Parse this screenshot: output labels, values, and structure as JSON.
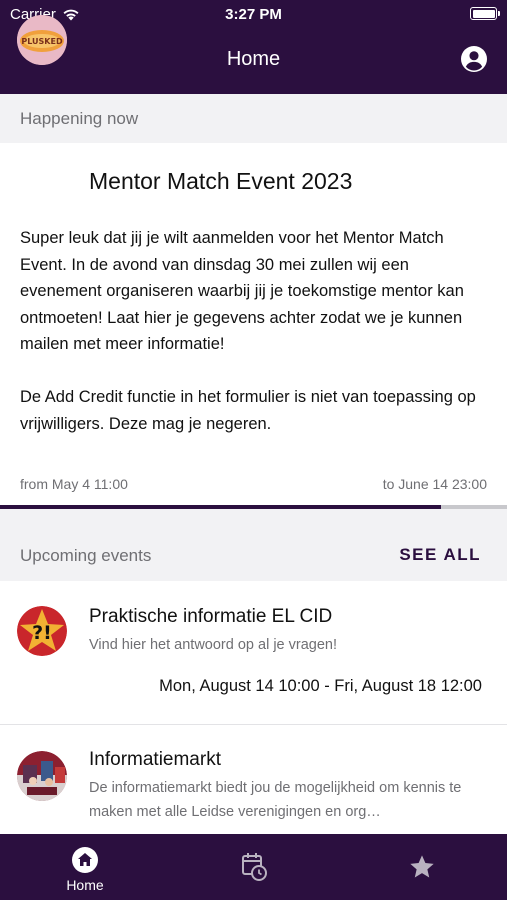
{
  "status_bar": {
    "carrier": "Carrier",
    "time": "3:27 PM"
  },
  "nav": {
    "title": "Home",
    "account_icon": "account-circle-icon"
  },
  "happening_now": {
    "header": "Happening now",
    "event": {
      "title": "Mentor Match Event 2023",
      "logo_text": "PLUSKED",
      "paragraphs": [
        "Super leuk dat jij je wilt aanmelden voor het Mentor Match Event. In de avond van dinsdag 30 mei zullen wij een evenement organiseren waarbij jij je toekomstige mentor kan ontmoeten! Laat hier je gegevens achter zodat we je kunnen mailen met meer informatie!",
        "De Add Credit functie in het formulier is niet van toepassing op vrijwilligers. Deze mag je negeren."
      ],
      "from": "from May 4 11:00",
      "to": "to June 14 23:00",
      "progress": 0.87
    }
  },
  "upcoming": {
    "header": "Upcoming events",
    "see_all": "SEE ALL",
    "events": [
      {
        "logo_text": "?!",
        "name": "Praktische informatie EL CID",
        "description": "Vind hier het antwoord op al je vragen!",
        "dates": "Mon, August 14 10:00 - Fri, August 18 12:00"
      },
      {
        "name": "Informatiemarkt",
        "description": "De informatiemarkt biedt jou de mogelijkheid om kennis te maken met alle Leidse verenigingen en org…"
      }
    ]
  },
  "tabbar": {
    "tabs": [
      {
        "label": "Home",
        "icon": "home-icon",
        "active": true
      },
      {
        "label": "",
        "icon": "calendar-clock-icon",
        "active": false
      },
      {
        "label": "",
        "icon": "star-icon",
        "active": false
      }
    ]
  },
  "colors": {
    "primary": "#2b0f3f",
    "background": "#f2f2f4",
    "muted_text": "#6f6f73"
  }
}
